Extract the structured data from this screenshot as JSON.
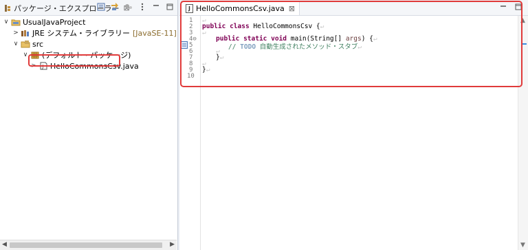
{
  "package_explorer": {
    "title": "パッケージ・エクスプローラー",
    "close": "⊠",
    "tree": [
      {
        "label": "UsualJavaProject",
        "twisty": "∨",
        "icon": "project-icon"
      },
      {
        "label": "JRE システム・ライブラリー",
        "hint": "[JavaSE-11]",
        "twisty": ">",
        "icon": "library-icon"
      },
      {
        "label": "src",
        "twisty": "∨",
        "icon": "source-folder-icon"
      },
      {
        "label": "(デフォルト・パッケージ)",
        "twisty": "∨",
        "icon": "package-icon"
      },
      {
        "label": "HelloCommonsCsv.java",
        "twisty": ">",
        "icon": "java-file-icon"
      }
    ]
  },
  "editor": {
    "tab_label": "HelloCommonsCsv.java",
    "tab_close": "⊠",
    "line_numbers": [
      "1",
      "2",
      "3",
      "4⊖",
      "5",
      "6",
      "7",
      "8",
      "9",
      "10"
    ],
    "code": {
      "l1": "↵",
      "l2_kw1": "public",
      "l2_kw2": "class",
      "l2_rest": " HelloCommonsCsv {",
      "l2_ret": "↵",
      "l3": "↵",
      "l4_kw1": "public",
      "l4_kw2": "static",
      "l4_kw3": "void",
      "l4_mid": " main(String[] ",
      "l4_arg": "args",
      "l4_end": ") {",
      "l4_ret": "↵",
      "l5_cmt1": "// ",
      "l5_todo": "TODO",
      "l5_cmt2": " 自動生成されたメソッド・スタブ",
      "l5_ret": "↵",
      "l6": "↵",
      "l7": "}",
      "l7_ret": "↵",
      "l8": "↵",
      "l9": "}",
      "l9_ret": "↵"
    }
  },
  "colors": {
    "keyword": "#7f0055",
    "comment": "#3f7f5f",
    "highlight": "#e03a3a"
  }
}
